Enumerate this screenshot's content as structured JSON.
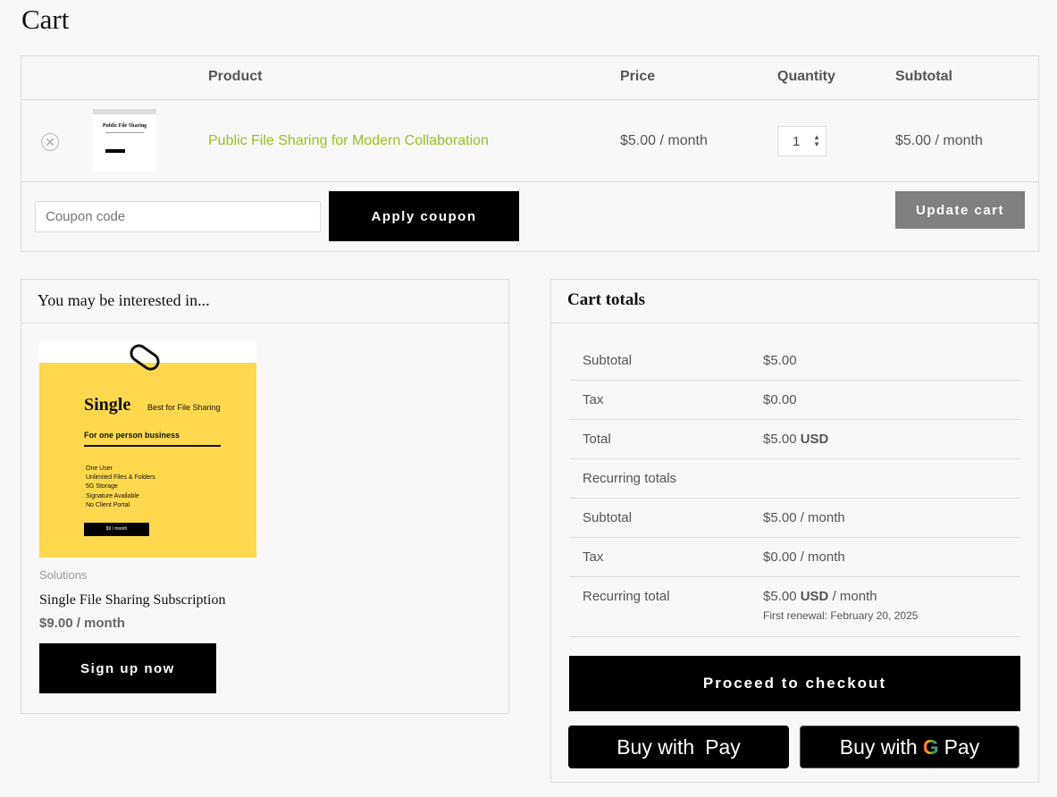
{
  "page_title": "Cart",
  "table": {
    "headers": {
      "product": "Product",
      "price": "Price",
      "quantity": "Quantity",
      "subtotal": "Subtotal"
    },
    "rows": [
      {
        "thumbnail_title": "Public File Sharing",
        "name": "Public File Sharing for Modern Collaboration",
        "price": "$5.00 / month",
        "quantity": "1",
        "subtotal": "$5.00 / month"
      }
    ],
    "coupon_placeholder": "Coupon code",
    "apply_coupon": "Apply coupon",
    "update_cart": "Update cart"
  },
  "cross_sells": {
    "heading": "You may be interested in...",
    "product": {
      "image_title": "Single",
      "image_tagline": "Best for File Sharing",
      "image_subtitle": "For one person business",
      "image_features": [
        "One User",
        "Unlimited Files & Folders",
        "5G Storage",
        "Signature Available",
        "No Client Portal"
      ],
      "image_price": "$9 / month",
      "category": "Solutions",
      "name": "Single File Sharing Subscription",
      "price": "$9.00 / month",
      "button": "Sign up now"
    }
  },
  "totals": {
    "heading": "Cart totals",
    "rows": [
      {
        "label": "Subtotal",
        "value": "$5.00"
      },
      {
        "label": "Tax",
        "value": "$0.00"
      },
      {
        "label": "Total",
        "value": "$5.00",
        "currency": "USD"
      },
      {
        "label": "Recurring totals",
        "value": ""
      },
      {
        "label": "Subtotal",
        "value": "$5.00 / month"
      },
      {
        "label": "Tax",
        "value": "$0.00 / month"
      },
      {
        "label": "Recurring total",
        "value": "$5.00",
        "currency": "USD",
        "suffix": "/ month",
        "note": "First renewal: February 20, 2025"
      }
    ],
    "checkout": "Proceed to checkout",
    "apple_pay": {
      "prefix": "Buy with",
      "brand": "Pay"
    },
    "google_pay": {
      "prefix": "Buy with",
      "brand": "Pay"
    }
  },
  "colors": {
    "link": "#97c21f",
    "yellow": "#ffd84d",
    "button": "#000000",
    "update_button": "#808080"
  }
}
